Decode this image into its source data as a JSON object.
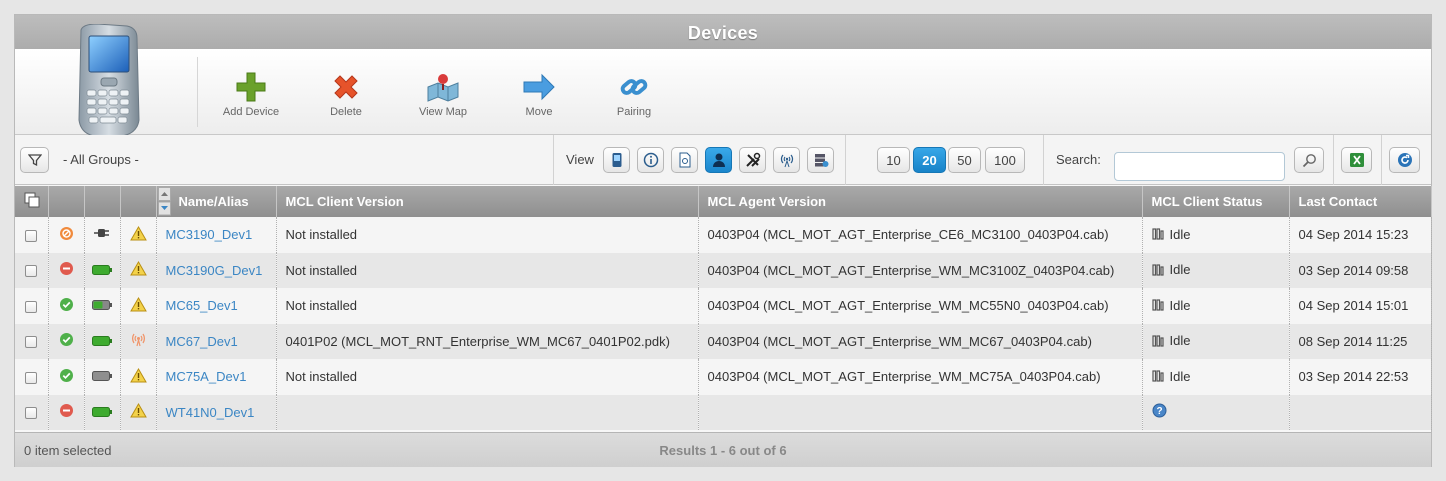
{
  "window": {
    "title": "Devices"
  },
  "ribbon": {
    "buttons": [
      {
        "label": "Add Device",
        "icon": "add-icon"
      },
      {
        "label": "Delete",
        "icon": "delete-icon"
      },
      {
        "label": "View Map",
        "icon": "map-icon"
      },
      {
        "label": "Move",
        "icon": "move-arrow-icon"
      },
      {
        "label": "Pairing",
        "icon": "link-icon"
      }
    ]
  },
  "toolbar": {
    "group_label": "- All Groups -",
    "view_label": "View",
    "view_icons": [
      "device-icon",
      "info-icon",
      "document-icon",
      "user-icon",
      "tools-icon",
      "signal-icon",
      "server-icon"
    ],
    "active_view_index": 3,
    "page_sizes": [
      "10",
      "20",
      "50",
      "100"
    ],
    "active_page_size": "20",
    "search_label": "Search:",
    "search_value": ""
  },
  "table": {
    "headers": [
      "Name/Alias",
      "MCL Client Version",
      "MCL Agent Version",
      "MCL Client Status",
      "Last Contact"
    ],
    "rows": [
      {
        "name": "MC3190_Dev1",
        "client_version": "Not installed",
        "agent_version": "0403P04 (MCL_MOT_AGT_Enterprise_CE6_MC3100_0403P04.cab)",
        "status": "Idle",
        "last_contact": "04 Sep 2014 15:23",
        "state_icon": "disabled",
        "power_icon": "plug",
        "alert_icon": "warning"
      },
      {
        "name": "MC3190G_Dev1",
        "client_version": "Not installed",
        "agent_version": "0403P04 (MCL_MOT_AGT_Enterprise_WM_MC3100Z_0403P04.cab)",
        "status": "Idle",
        "last_contact": "03 Sep 2014 09:58",
        "state_icon": "stop",
        "power_icon": "battery-full",
        "alert_icon": "warning"
      },
      {
        "name": "MC65_Dev1",
        "client_version": "Not installed",
        "agent_version": "0403P04 (MCL_MOT_AGT_Enterprise_WM_MC55N0_0403P04.cab)",
        "status": "Idle",
        "last_contact": "04 Sep 2014 15:01",
        "state_icon": "ok",
        "power_icon": "battery-half",
        "alert_icon": "warning"
      },
      {
        "name": "MC67_Dev1",
        "client_version": "0401P02 (MCL_MOT_RNT_Enterprise_WM_MC67_0401P02.pdk)",
        "agent_version": "0403P04 (MCL_MOT_AGT_Enterprise_WM_MC67_0403P04.cab)",
        "status": "Idle",
        "last_contact": "08 Sep 2014 11:25",
        "state_icon": "ok",
        "power_icon": "battery-full",
        "alert_icon": "signal"
      },
      {
        "name": "MC75A_Dev1",
        "client_version": "Not installed",
        "agent_version": "0403P04 (MCL_MOT_AGT_Enterprise_WM_MC75A_0403P04.cab)",
        "status": "Idle",
        "last_contact": "03 Sep 2014 22:53",
        "state_icon": "ok",
        "power_icon": "battery-empty",
        "alert_icon": "warning"
      },
      {
        "name": "WT41N0_Dev1",
        "client_version": "",
        "agent_version": "",
        "status": "",
        "last_contact": "",
        "state_icon": "stop",
        "power_icon": "battery-full",
        "alert_icon": "warning",
        "status_icon": "help"
      }
    ]
  },
  "footer": {
    "selection_text": "0 item selected",
    "results_text": "Results 1 - 6 out of 6"
  },
  "colors": {
    "accent": "#1a86cc",
    "link": "#3b86c4",
    "header": "#9d9d9d"
  }
}
